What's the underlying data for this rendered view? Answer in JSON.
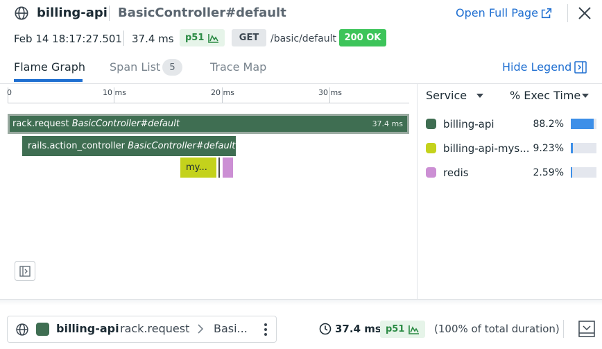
{
  "header": {
    "service": "billing-api",
    "resource": "BasicController#default",
    "open_full_page": "Open Full Page",
    "date": "Feb 14 18:17:27.501",
    "duration": "37.4 ms",
    "percentile": "p51",
    "method": "GET",
    "path": "/basic/default",
    "status": "200 OK"
  },
  "tabs": {
    "flame_graph": "Flame Graph",
    "span_list": "Span List",
    "span_count": "5",
    "trace_map": "Trace Map",
    "hide_legend": "Hide Legend",
    "active": "Flame Graph"
  },
  "flame": {
    "ticks": [
      "0",
      "10 ms",
      "20 ms",
      "30 ms"
    ],
    "spans": {
      "rack": {
        "operation": "rack.request",
        "resource": "BasicController#default",
        "duration": "37.4 ms",
        "color": "#3f6e52"
      },
      "rails": {
        "operation": "rails.action_controller",
        "resource": "BasicController#default",
        "color": "#3f6e52"
      },
      "mysql": {
        "label": "my...",
        "color": "#c4d21c"
      },
      "redis": {
        "color": "#cc8fd4"
      }
    }
  },
  "legend": {
    "service_header": "Service",
    "exec_header": "% Exec Time",
    "rows": [
      {
        "name": "billing-api",
        "pct": "88.2%",
        "fraction": 0.882,
        "color": "#3f6e52"
      },
      {
        "name": "billing-api-mys...",
        "pct": "9.23%",
        "fraction": 0.0923,
        "color": "#c4d21c"
      },
      {
        "name": "redis",
        "pct": "2.59%",
        "fraction": 0.0259,
        "color": "#cc8fd4"
      }
    ],
    "bar_color": "#3d8fe8"
  },
  "footer": {
    "service": "billing-api",
    "operation": "rack.request",
    "resource": "Basi...",
    "duration": "37.4 ms",
    "percentile": "p51",
    "total": "(100% of total duration)"
  },
  "colors": {
    "accent": "#1f6fd1",
    "success": "#3dc45a"
  }
}
